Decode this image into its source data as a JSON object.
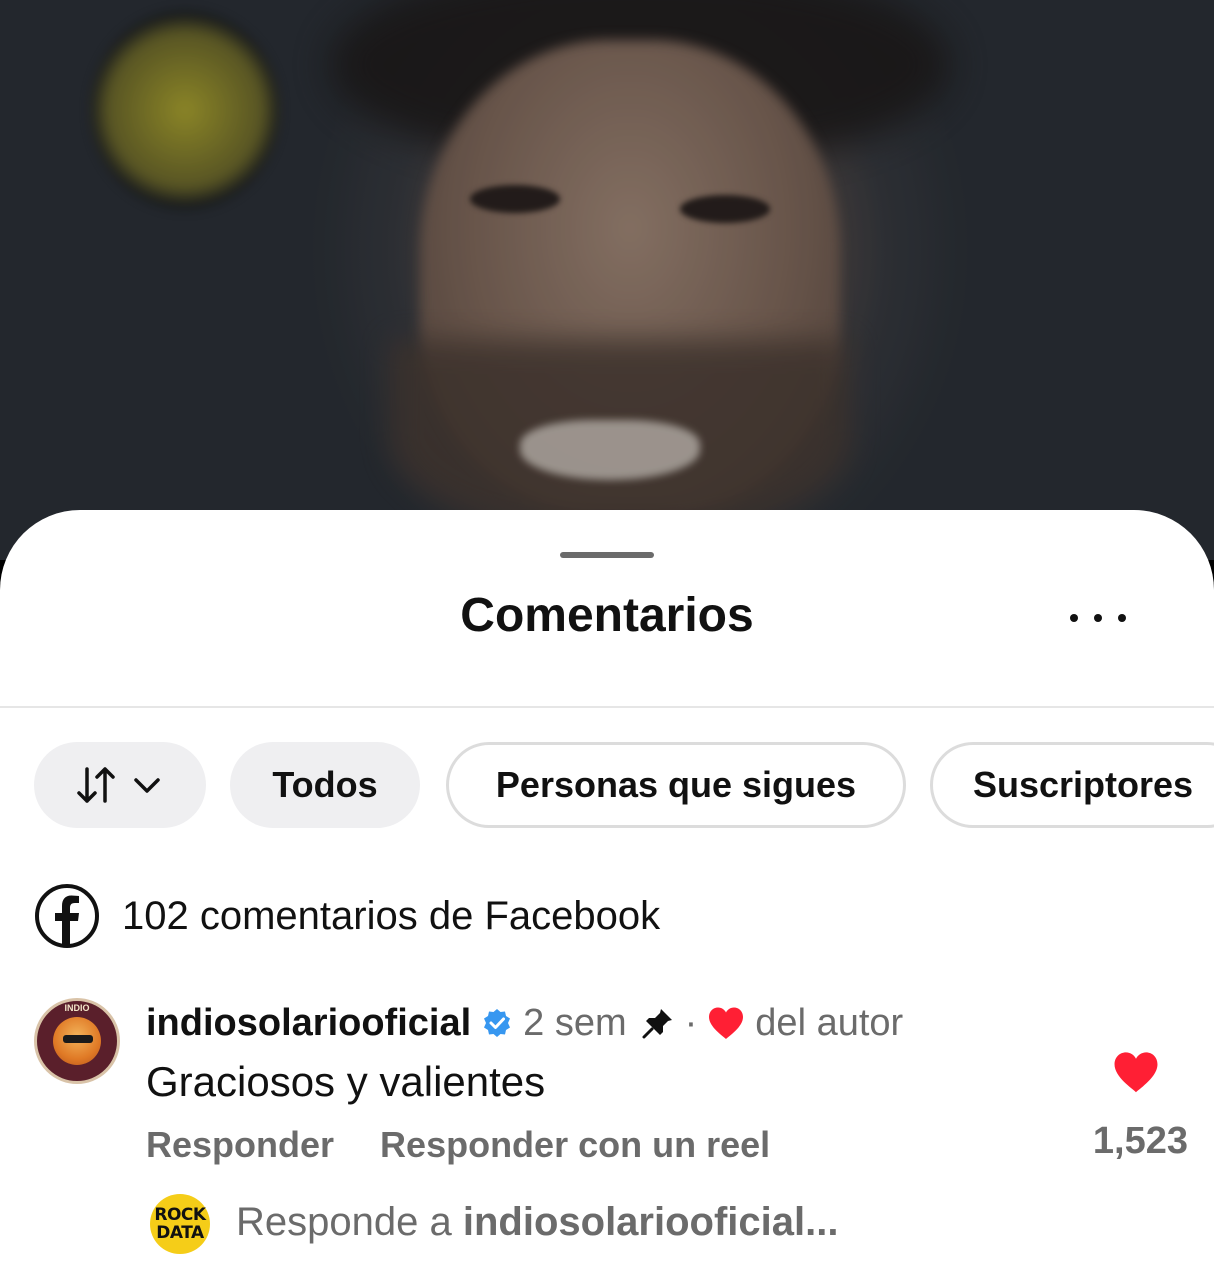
{
  "header": {
    "title": "Comentarios"
  },
  "filters": {
    "todos": "Todos",
    "sigues": "Personas que sigues",
    "suscriptores": "Suscriptores"
  },
  "facebook_row": {
    "label": "102 comentarios de Facebook"
  },
  "comment": {
    "username": "indiosolariooficial",
    "time": "2 sem",
    "separator": "·",
    "author_like_label": "del autor",
    "text": "Graciosos y valientes",
    "reply_label": "Responder",
    "reply_reel_label": "Responder con un reel",
    "like_count": "1,523",
    "avatar_text": "INDIO"
  },
  "reply_input": {
    "avatar_line1": "ROCK",
    "avatar_line2": "DATA",
    "prefix": "Responde a",
    "target": "indiosolariooficial..."
  },
  "colors": {
    "like_red": "#ff1f34",
    "verified_blue": "#3797f0",
    "muted": "#6b6b6b"
  }
}
